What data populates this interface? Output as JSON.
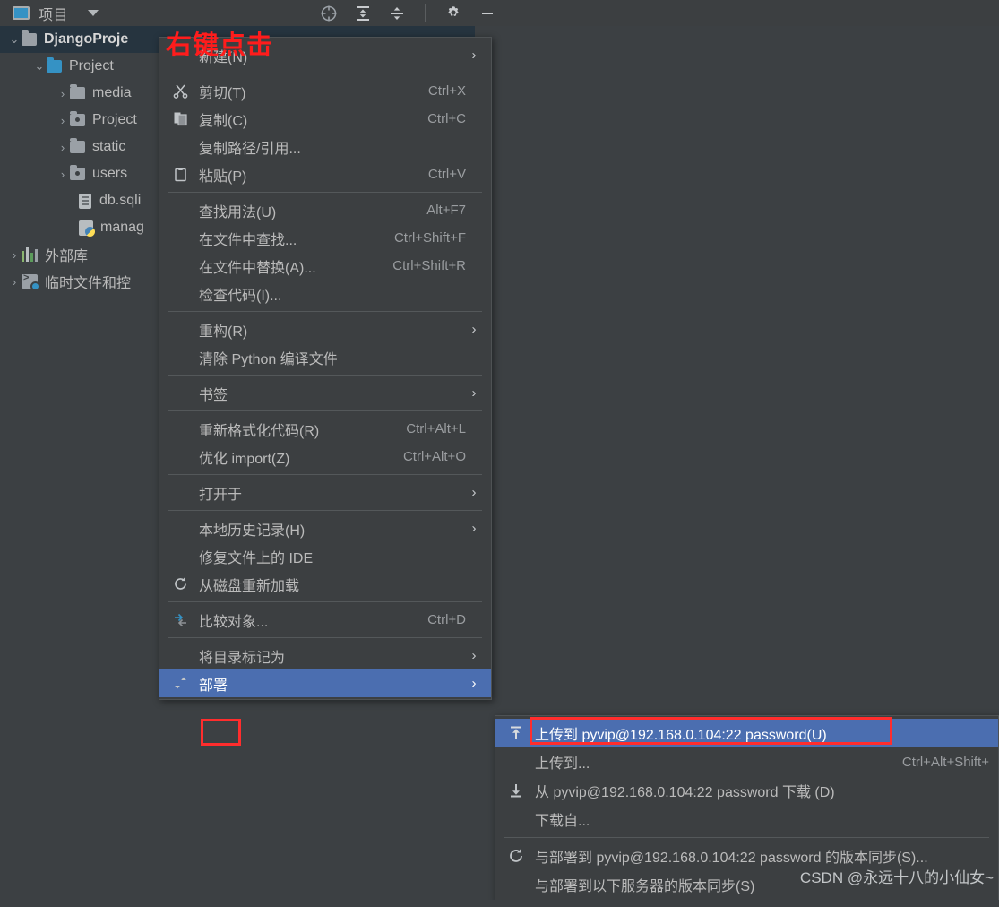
{
  "toolbar": {
    "title": "项目",
    "icons": [
      {
        "name": "locate-icon",
        "glyph": "target"
      },
      {
        "name": "expand-all-icon",
        "glyph": "expand"
      },
      {
        "name": "collapse-all-icon",
        "glyph": "collapse"
      },
      {
        "name": "settings-gear-icon",
        "glyph": "gear"
      },
      {
        "name": "minimize-icon",
        "glyph": "minus"
      }
    ]
  },
  "tree": {
    "items": [
      {
        "label": "DjangoProje",
        "chev": "⌄",
        "icon": "folder",
        "depth": 0,
        "selected": true,
        "bold": true
      },
      {
        "label": "Project",
        "chev": "⌄",
        "icon": "folder-blue",
        "depth": 1,
        "selected": false,
        "bold": false
      },
      {
        "label": "media",
        "chev": "›",
        "icon": "folder",
        "depth": 2,
        "selected": false,
        "bold": false
      },
      {
        "label": "Project",
        "chev": "›",
        "icon": "folder-src",
        "depth": 2,
        "selected": false,
        "bold": false
      },
      {
        "label": "static",
        "chev": "›",
        "icon": "folder",
        "depth": 2,
        "selected": false,
        "bold": false
      },
      {
        "label": "users",
        "chev": "›",
        "icon": "folder-src",
        "depth": 2,
        "selected": false,
        "bold": false
      },
      {
        "label": "db.sqli",
        "chev": "",
        "icon": "file-db",
        "depth": 3,
        "selected": false,
        "bold": false
      },
      {
        "label": "manag",
        "chev": "",
        "icon": "file-python",
        "depth": 3,
        "selected": false,
        "bold": false
      },
      {
        "label": "外部库",
        "chev": "›",
        "icon": "external-libraries",
        "depth": 0,
        "selected": false,
        "bold": false
      },
      {
        "label": "临时文件和控",
        "chev": "›",
        "icon": "scratches",
        "depth": 0,
        "selected": false,
        "bold": false
      }
    ]
  },
  "annotations": {
    "right_click_label": "右键点击",
    "watermark": "CSDN @永远十八的小仙女~"
  },
  "context_menu": {
    "items": [
      {
        "type": "item",
        "label": "新建(N)",
        "shortcut": "",
        "arrow": "›",
        "icon": "",
        "highlight": false
      },
      {
        "type": "sep"
      },
      {
        "type": "item",
        "label": "剪切(T)",
        "shortcut": "Ctrl+X",
        "arrow": "",
        "icon": "cut-icon",
        "highlight": false
      },
      {
        "type": "item",
        "label": "复制(C)",
        "shortcut": "Ctrl+C",
        "arrow": "",
        "icon": "copy-icon",
        "highlight": false
      },
      {
        "type": "item",
        "label": "复制路径/引用...",
        "shortcut": "",
        "arrow": "",
        "icon": "",
        "highlight": false
      },
      {
        "type": "item",
        "label": "粘贴(P)",
        "shortcut": "Ctrl+V",
        "arrow": "",
        "icon": "paste-icon",
        "highlight": false
      },
      {
        "type": "sep"
      },
      {
        "type": "item",
        "label": "查找用法(U)",
        "shortcut": "Alt+F7",
        "arrow": "",
        "icon": "",
        "highlight": false
      },
      {
        "type": "item",
        "label": "在文件中查找...",
        "shortcut": "Ctrl+Shift+F",
        "arrow": "",
        "icon": "",
        "highlight": false
      },
      {
        "type": "item",
        "label": "在文件中替换(A)...",
        "shortcut": "Ctrl+Shift+R",
        "arrow": "",
        "icon": "",
        "highlight": false
      },
      {
        "type": "item",
        "label": "检查代码(I)...",
        "shortcut": "",
        "arrow": "",
        "icon": "",
        "highlight": false
      },
      {
        "type": "sep"
      },
      {
        "type": "item",
        "label": "重构(R)",
        "shortcut": "",
        "arrow": "›",
        "icon": "",
        "highlight": false
      },
      {
        "type": "item",
        "label": "清除 Python 编译文件",
        "shortcut": "",
        "arrow": "",
        "icon": "",
        "highlight": false
      },
      {
        "type": "sep"
      },
      {
        "type": "item",
        "label": "书签",
        "shortcut": "",
        "arrow": "›",
        "icon": "",
        "highlight": false
      },
      {
        "type": "sep"
      },
      {
        "type": "item",
        "label": "重新格式化代码(R)",
        "shortcut": "Ctrl+Alt+L",
        "arrow": "",
        "icon": "",
        "highlight": false
      },
      {
        "type": "item",
        "label": "优化 import(Z)",
        "shortcut": "Ctrl+Alt+O",
        "arrow": "",
        "icon": "",
        "highlight": false
      },
      {
        "type": "sep"
      },
      {
        "type": "item",
        "label": "打开于",
        "shortcut": "",
        "arrow": "›",
        "icon": "",
        "highlight": false
      },
      {
        "type": "sep"
      },
      {
        "type": "item",
        "label": "本地历史记录(H)",
        "shortcut": "",
        "arrow": "›",
        "icon": "",
        "highlight": false
      },
      {
        "type": "item",
        "label": "修复文件上的 IDE",
        "shortcut": "",
        "arrow": "",
        "icon": "",
        "highlight": false
      },
      {
        "type": "item",
        "label": "从磁盘重新加载",
        "shortcut": "",
        "arrow": "",
        "icon": "refresh-icon",
        "highlight": false
      },
      {
        "type": "sep"
      },
      {
        "type": "item",
        "label": "比较对象...",
        "shortcut": "Ctrl+D",
        "arrow": "",
        "icon": "compare-icon",
        "highlight": false
      },
      {
        "type": "sep"
      },
      {
        "type": "item",
        "label": "将目录标记为",
        "shortcut": "",
        "arrow": "›",
        "icon": "",
        "highlight": false
      },
      {
        "type": "item",
        "label": "部署",
        "shortcut": "",
        "arrow": "›",
        "icon": "deploy-icon",
        "highlight": true
      }
    ]
  },
  "submenu": {
    "items": [
      {
        "type": "item",
        "label": "上传到 pyvip@192.168.0.104:22 password(U)",
        "shortcut": "",
        "icon": "upload-icon",
        "highlight": true
      },
      {
        "type": "item",
        "label": "上传到...",
        "shortcut": "Ctrl+Alt+Shift+",
        "icon": "",
        "highlight": false
      },
      {
        "type": "item",
        "label": "从 pyvip@192.168.0.104:22 password 下载 (D)",
        "shortcut": "",
        "icon": "download-icon",
        "highlight": false
      },
      {
        "type": "item",
        "label": "下载自...",
        "shortcut": "",
        "icon": "",
        "highlight": false
      },
      {
        "type": "sep"
      },
      {
        "type": "item",
        "label": "与部署到 pyvip@192.168.0.104:22 password 的版本同步(S)...",
        "shortcut": "",
        "icon": "sync-icon",
        "highlight": false
      },
      {
        "type": "item",
        "label": "与部署到以下服务器的版本同步(S)",
        "shortcut": "",
        "icon": "",
        "highlight": false
      }
    ]
  },
  "colors": {
    "menu_bg": "#3c3f41",
    "panel_bg": "#3c4043",
    "highlight_blue": "#4b6eb0",
    "selection_navy": "#26343f",
    "accent_red": "#ff2d2d",
    "text": "#bbbbbb"
  }
}
